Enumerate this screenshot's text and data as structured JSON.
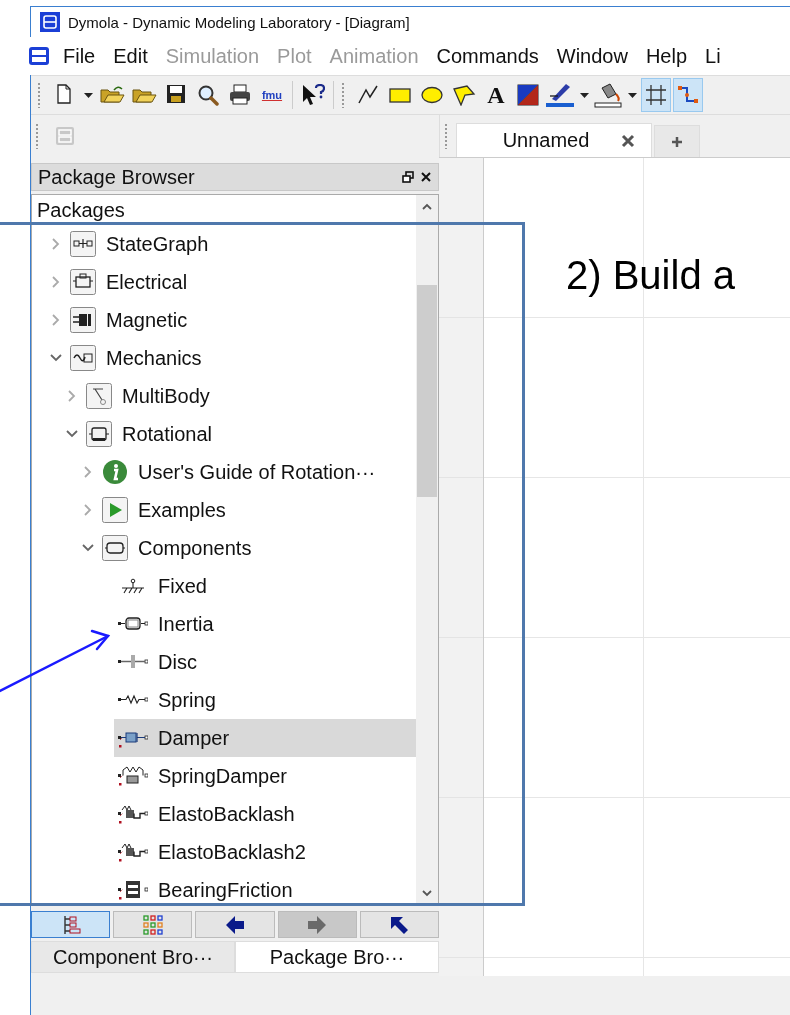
{
  "window": {
    "title": "Dymola - Dynamic Modeling Laboratory - [Diagram]"
  },
  "menu": [
    {
      "label": "File",
      "disabled": false
    },
    {
      "label": "Edit",
      "disabled": false
    },
    {
      "label": "Simulation",
      "disabled": true
    },
    {
      "label": "Plot",
      "disabled": true
    },
    {
      "label": "Animation",
      "disabled": true
    },
    {
      "label": "Commands",
      "disabled": false
    },
    {
      "label": "Window",
      "disabled": false
    },
    {
      "label": "Help",
      "disabled": false
    },
    {
      "label": "Li",
      "disabled": false
    }
  ],
  "toolbar": [
    {
      "kind": "new",
      "selected": false
    },
    {
      "kind": "caret",
      "selected": false
    },
    {
      "kind": "open-file",
      "selected": false
    },
    {
      "kind": "open",
      "selected": false
    },
    {
      "kind": "save",
      "selected": false
    },
    {
      "kind": "find",
      "selected": false
    },
    {
      "kind": "print",
      "selected": false
    },
    {
      "kind": "text",
      "label": "fmu",
      "selected": false
    },
    {
      "kind": "separator"
    },
    {
      "kind": "help",
      "selected": false
    },
    {
      "kind": "group"
    },
    {
      "kind": "line",
      "selected": false
    },
    {
      "kind": "rect",
      "selected": false
    },
    {
      "kind": "ellipse",
      "selected": false
    },
    {
      "kind": "polygon",
      "selected": false
    },
    {
      "kind": "glyph",
      "label": "A",
      "selected": false
    },
    {
      "kind": "color",
      "selected": false
    },
    {
      "kind": "pen",
      "selected": false
    },
    {
      "kind": "caret",
      "selected": false
    },
    {
      "kind": "fill",
      "selected": false
    },
    {
      "kind": "caret",
      "selected": false
    },
    {
      "kind": "grid",
      "selected": true
    },
    {
      "kind": "connect",
      "selected": true
    }
  ],
  "document_tabs": [
    {
      "label": "Unnamed",
      "selected": true
    }
  ],
  "package_browser": {
    "title": "Package Browser",
    "column_header": "Packages",
    "tree": [
      {
        "label": "StateGraph",
        "kind": "package",
        "expanded": false,
        "selected": false
      },
      {
        "label": "Electrical",
        "kind": "package",
        "expanded": false,
        "selected": false
      },
      {
        "label": "Magnetic",
        "kind": "package",
        "expanded": false,
        "selected": false
      },
      {
        "label": "Mechanics",
        "kind": "package",
        "expanded": true,
        "selected": false,
        "children": [
          {
            "label": "MultiBody",
            "kind": "package",
            "expanded": false,
            "selected": false
          },
          {
            "label": "Rotational",
            "kind": "package",
            "expanded": true,
            "selected": false,
            "children": [
              {
                "label": "User's Guide of Rotation···",
                "kind": "info",
                "expanded": false,
                "selected": false
              },
              {
                "label": "Examples",
                "kind": "examples",
                "expanded": false,
                "selected": false
              },
              {
                "label": "Components",
                "kind": "package",
                "expanded": true,
                "selected": false,
                "children": [
                  {
                    "label": "Fixed",
                    "kind": "fixed",
                    "selected": false
                  },
                  {
                    "label": "Inertia",
                    "kind": "inertia",
                    "selected": false
                  },
                  {
                    "label": "Disc",
                    "kind": "disc",
                    "selected": false
                  },
                  {
                    "label": "Spring",
                    "kind": "spring",
                    "selected": false
                  },
                  {
                    "label": "Damper",
                    "kind": "damper",
                    "selected": true
                  },
                  {
                    "label": "SpringDamper",
                    "kind": "spring-damper",
                    "selected": false
                  },
                  {
                    "label": "ElastoBacklash",
                    "kind": "backlash",
                    "selected": false
                  },
                  {
                    "label": "ElastoBacklash2",
                    "kind": "backlash",
                    "selected": false
                  },
                  {
                    "label": "BearingFriction",
                    "kind": "bearing",
                    "selected": false
                  }
                ]
              }
            ]
          }
        ]
      }
    ],
    "view_buttons": [
      {
        "kind": "tree",
        "selected": true,
        "disabled": false
      },
      {
        "kind": "grid",
        "selected": false,
        "disabled": false
      },
      {
        "kind": "back",
        "selected": false,
        "disabled": false
      },
      {
        "kind": "forward",
        "selected": false,
        "disabled": true
      },
      {
        "kind": "up",
        "selected": false,
        "disabled": false
      }
    ],
    "browser_tabs": [
      {
        "label": "Component Bro···",
        "selected": false
      },
      {
        "label": "Package Bro···",
        "selected": true
      }
    ]
  },
  "annotation": {
    "text": "2) Build a"
  }
}
